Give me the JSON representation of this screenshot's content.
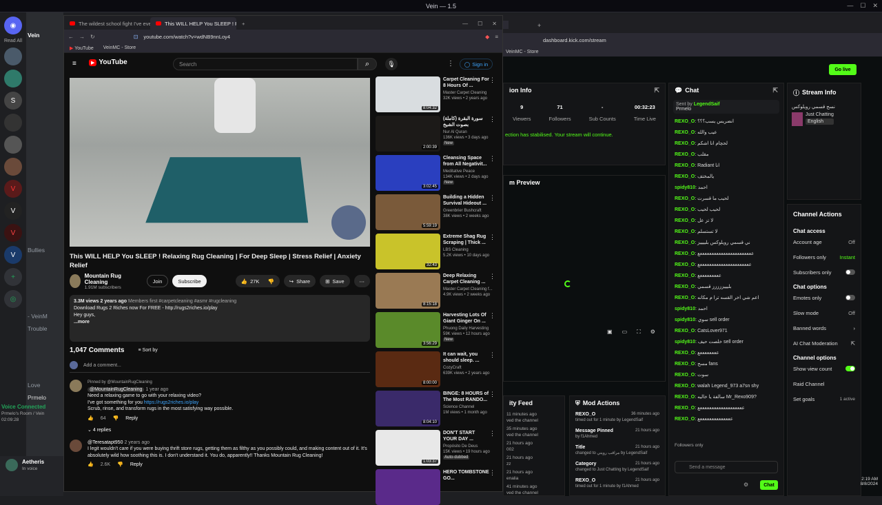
{
  "topbar": {
    "title": "Vein — 1.5"
  },
  "discord": {
    "read_all": "Read All",
    "server": "Vein",
    "channels": [
      "Bullies",
      "- VeinM",
      "Trouble",
      "Love",
      "Prmelo"
    ],
    "voice_connected": "Voice Connected",
    "voice_room": "Prmelo's Room / Vein",
    "voice_time": "02:09:28",
    "user": "Aetheris",
    "user_status": "In voice"
  },
  "browser": {
    "tabs": [
      "The wildest school fight I've ever bee",
      "This WILL HELP You SLEEP ! Rela"
    ],
    "url": "youtube.com/watch?v=wdNB9nnLoy4",
    "bookmarks": [
      "YouTube",
      "VeinMC - Store"
    ]
  },
  "youtube": {
    "logo": "YouTube",
    "search_placeholder": "Search",
    "sign_in": "Sign in",
    "title": "This WILL HELP You SLEEP ! Relaxing Rug Cleaning | For Deep Sleep | Stress Relief | Anxiety Relief",
    "channel": "Mountain Rug Cleaning",
    "subs": "1.91M subscribers",
    "join": "Join",
    "subscribe": "Subscribe",
    "likes": "27K",
    "share": "Share",
    "save": "Save",
    "desc_meta": "3.3M views  2 years ago",
    "desc_tags": "Members first  #carpetcleaning #asmr #rugcleaning",
    "desc_line1": "Download Rugs 2 Riches now For FREE - http://rugs2riches.io/play",
    "desc_line2": "Hey guys,",
    "desc_more": "...more",
    "comments_count": "1,047 Comments",
    "sort_by": "Sort by",
    "add_comment": "Add a comment...",
    "c1_pinned": "Pinned by @MountainRugCleaning",
    "c1_author": "@MountainRugCleaning",
    "c1_time": "1 year ago",
    "c1_text1": "Need a relaxing game to go with your relaxing video?",
    "c1_text2": "I've got something for you",
    "c1_link": "https://rugs2riches.io/play",
    "c1_text3": "Scrub, rinse, and transform rugs in the most satisfying way possible.",
    "c1_likes": "64",
    "c1_reply": "Reply",
    "c1_replies": "4 replies",
    "c2_author": "@Teresatapt950",
    "c2_time": "2 years ago",
    "c2_text": "I legit wouldn't care if you were buying thrift store rugs, getting them as filthy as you possibly could, and making content out of it. It's absolutely wild how soothing this is. I don't understand it. You do, apparently!! Thanks Mountain Rug Cleaning!",
    "c2_likes": "2.6K",
    "c2_reply": "Reply",
    "sidebar": [
      {
        "title": "Carpet Cleaning For 8 Hours Of ...",
        "channel": "Master Carpet Cleaning",
        "meta": "32K views • 2 years ago",
        "dur": "8:04:32",
        "color": "#d9dde0"
      },
      {
        "title": "سورة البقرة (كاملة) بصوت الشيخ",
        "channel": "Nur Al Quran",
        "meta": "136K views • 3 days ago",
        "dur": "2:00:39",
        "color": "#1c1a18",
        "badge": "New"
      },
      {
        "title": "Cleansing Space from All Negativit...",
        "channel": "Meditative Peace",
        "meta": "134K views • 2 days ago",
        "dur": "3:02:45",
        "color": "#2a3fbf",
        "badge": "New"
      },
      {
        "title": "Building a Hidden Survival Hideout ...",
        "channel": "Greenbrier Bushcraft",
        "meta": "38K views • 2 weeks ago",
        "dur": "5:59:19",
        "color": "#7a5a3a"
      },
      {
        "title": "Extreme Shag Rug Scraping | Thick ...",
        "channel": "LBS Cleaning",
        "meta": "5.2K views • 10 days ago",
        "dur": "32:43",
        "color": "#c9c32a"
      },
      {
        "title": "Deep Relaxing Carpet Cleaning ...",
        "channel": "Master Carpet Cleaning f...",
        "meta": "4.9K views • 2 weeks ago",
        "dur": "8:15:18",
        "color": "#9a7a54"
      },
      {
        "title": "Harvesting Lots Of Giant Ginger On ...",
        "channel": "Phuong Daily Harvesting",
        "meta": "59K views • 12 hours ago",
        "dur": "3:56:29",
        "color": "#5a8a2a",
        "badge": "New"
      },
      {
        "title": "It can wait, you should sleep. ...",
        "channel": "CozyCraft",
        "meta": "639K views • 2 years ago",
        "dur": "8:00:00",
        "color": "#5a2a12"
      },
      {
        "title": "BINGE: 8 HOURS of The Most RANDO...",
        "channel": "Science Channel",
        "meta": "1M views • 1 month ago",
        "dur": "8:04:10",
        "color": "#3a2a6a"
      },
      {
        "title": "DON'T START YOUR DAY ...",
        "channel": "Propósito De Deus",
        "meta": "15K views • 19 hours ago",
        "dur": "1:03:37",
        "color": "#e8e8e8",
        "badge": "Auto-dubbed"
      },
      {
        "title": "HERO TOMBSTONE GO...",
        "channel": "",
        "meta": "",
        "dur": "",
        "color": "#5a2a8a"
      }
    ]
  },
  "kick": {
    "url": "dashboard.kick.com/stream",
    "bookmark": "VeinMC - Store",
    "go_live": "Go live",
    "session_title": "ion Info",
    "stats": [
      {
        "v": "9",
        "l": "Viewers"
      },
      {
        "v": "71",
        "l": "Followers"
      },
      {
        "v": "-",
        "l": "Sub Counts"
      },
      {
        "v": "00:32:23",
        "l": "Time Live"
      }
    ],
    "status_msg": "ection has stabilised. Your stream will continue.",
    "preview_title": "m Preview",
    "activity_title": "ity Feed",
    "activity": [
      {
        "t": "11 minutes ago",
        "s": "ved the channel"
      },
      {
        "t": "35 minutes ago",
        "s": "ved the channel"
      },
      {
        "t": "21 hours ago",
        "s": "002"
      },
      {
        "t": "21 hours ago",
        "s": "zz"
      },
      {
        "t": "21 hours ago",
        "s": "enalia"
      },
      {
        "t": "41 minutes ago",
        "s": "ved the channel"
      }
    ],
    "mod_title": "Mod Actions",
    "mods": [
      {
        "n": "REXO_O",
        "t": "36 minutes ago",
        "d": "timed out for 1 minute by LegendSaif"
      },
      {
        "n": "Message Pinned",
        "t": "21 hours ago",
        "d": "by f1Ahmed"
      },
      {
        "n": "Title",
        "t": "21 hours ago",
        "d": "changed to مراقب رويتي by LegendSaif"
      },
      {
        "n": "Category",
        "t": "21 hours ago",
        "d": "changed to Just Chatting by LegendSaif"
      },
      {
        "n": "REXO_O",
        "t": "21 hours ago",
        "d": "timed out for 1 minute by f1Ahmed"
      }
    ],
    "chat_title": "Chat",
    "pinned_by": "Sent by",
    "pinned_user": "LegendSaif",
    "pinned_msg": "Prmelo",
    "chat": [
      {
        "u": "REXO_O",
        "m": "انضريس يسب؟؟؟"
      },
      {
        "u": "REXO_O",
        "m": "عيب والله"
      },
      {
        "u": "REXO_O",
        "m": "لحچام انا اشكم"
      },
      {
        "u": "REXO_O",
        "m": "مقلب"
      },
      {
        "u": "REXO_O",
        "m": "Radiant انا"
      },
      {
        "u": "REXO_O",
        "m": "يالمختف"
      },
      {
        "u": "spidy810",
        "m": "احمد"
      },
      {
        "u": "REXO_O",
        "m": "لحيب ما قسرت"
      },
      {
        "u": "REXO_O",
        "m": "لحيب لحيب"
      },
      {
        "u": "REXO_O",
        "m": "لا تز عل"
      },
      {
        "u": "REXO_O",
        "m": "لا تستسلم"
      },
      {
        "u": "REXO_O",
        "m": "ني قسمي رويلوكس بلييييز"
      },
      {
        "u": "REXO_O",
        "m": "عععععععععععععععععععععععع"
      },
      {
        "u": "REXO_O",
        "m": "ععععععععععععععععععععععع"
      },
      {
        "u": "REXO_O",
        "m": "عععععععععع"
      },
      {
        "u": "REXO_O",
        "m": "بليييززززز قسمي"
      },
      {
        "u": "REXO_O",
        "m": "اعم شي اخر القسه ترا م مكانه"
      },
      {
        "u": "spidy810",
        "m": "احمد"
      },
      {
        "u": "spidy810",
        "m": "سوي sell order"
      },
      {
        "u": "REXO_O",
        "m": "CatsLover971"
      },
      {
        "u": "spidy810",
        "m": "خلصت حيف sell order"
      },
      {
        "u": "REXO_O",
        "m": "ععععععععع"
      },
      {
        "u": "REXO_O",
        "m": "مسح fans"
      },
      {
        "u": "REXO_O",
        "m": "سوت"
      },
      {
        "u": "REXO_O",
        "m": "walah Legend_973 a7sn shy"
      },
      {
        "u": "REXO_O",
        "m": "سالفة يا خاليه Mr_Rexo909?"
      },
      {
        "u": "REXO_O",
        "m": "عععععععععععععععععععع"
      },
      {
        "u": "REXO_O",
        "m": "ععععععععععععععع"
      }
    ],
    "followers_only": "Followers only",
    "send_placeholder": "Send a message",
    "chat_btn": "Chat",
    "stream_info": "Stream Info",
    "stream_title": "نسح قسمي رويلوكس",
    "category": "Just Chatting",
    "lang": "English",
    "channel_actions": "Channel Actions",
    "chat_access": "Chat access",
    "account_age": "Account age",
    "account_age_val": "Off",
    "followers_only_opt": "Followers only",
    "followers_only_val": "Instant",
    "subs_only": "Subscribers only",
    "chat_options": "Chat options",
    "emotes_only": "Emotes only",
    "slow_mode": "Slow mode",
    "slow_mode_val": "Off",
    "banned_words": "Banned words",
    "ai_mod": "AI Chat Moderation",
    "channel_options": "Channel options",
    "show_viewer": "Show view count",
    "raid": "Raid Channel",
    "set_goals": "Set goals",
    "goals_val": "1 active",
    "clock_time": "2:19 AM",
    "clock_date": "8/8/2024"
  }
}
